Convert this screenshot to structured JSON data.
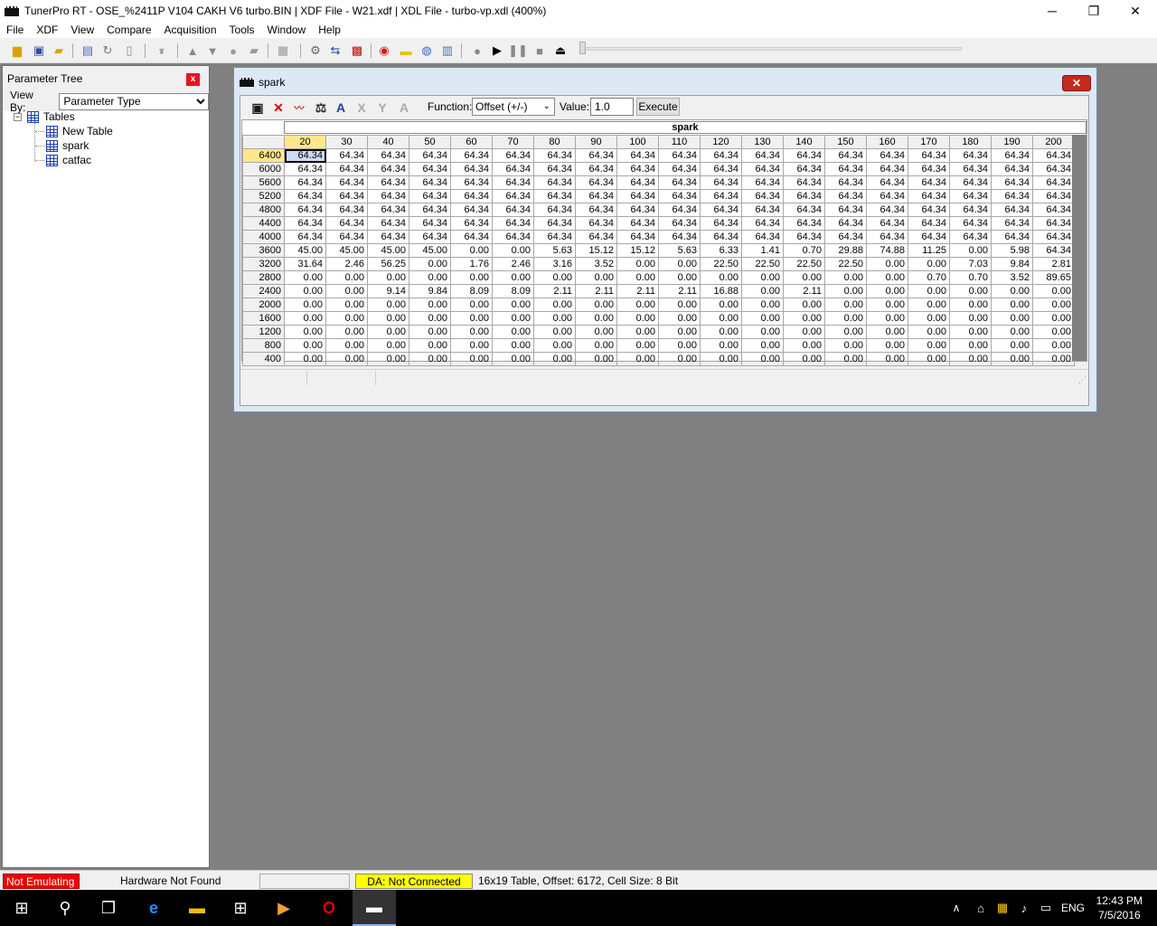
{
  "app": {
    "title": "TunerPro RT - OSE_%2411P V104 CAKH V6 turbo.BIN | XDF File - W21.xdf | XDL File - turbo-vp.xdl (400%)",
    "minimize_glyph": "─",
    "maximize_glyph": "❐",
    "close_glyph": "✕"
  },
  "menu": [
    "File",
    "XDF",
    "View",
    "Compare",
    "Acquisition",
    "Tools",
    "Window",
    "Help"
  ],
  "toolbar_icons": [
    "open-folder-icon",
    "save-icon",
    "open-file-icon",
    "export-icon",
    "refresh-icon",
    "new-icon",
    "probe-icon",
    "arrow-up-icon",
    "arrow-down-icon",
    "circle-icon",
    "stack-icon",
    "chip-icon",
    "settings-icon",
    "swap-icon",
    "compare-icon",
    "record-icon",
    "notes-icon",
    "globe-icon",
    "chart-icon",
    "dot-icon",
    "play-icon",
    "pause-icon",
    "stop-icon",
    "eject-icon"
  ],
  "param_tree": {
    "title": "Parameter Tree",
    "view_by_label": "View By:",
    "view_by_value": "Parameter Type",
    "close_label": "x",
    "root": "Tables",
    "children": [
      "New Table",
      "spark",
      "catfac"
    ]
  },
  "spark_window": {
    "title": "spark",
    "close_label": "✕",
    "function_label": "Function:",
    "function_value": "Offset (+/-)",
    "value_label": "Value:",
    "value": "1.0",
    "execute_label": "Execute",
    "table_title": "spark",
    "columns": [
      "20",
      "30",
      "40",
      "50",
      "60",
      "70",
      "80",
      "90",
      "100",
      "110",
      "120",
      "130",
      "140",
      "150",
      "160",
      "170",
      "180",
      "190",
      "200"
    ],
    "rows": [
      {
        "label": "6400",
        "values": [
          "64.34",
          "64.34",
          "64.34",
          "64.34",
          "64.34",
          "64.34",
          "64.34",
          "64.34",
          "64.34",
          "64.34",
          "64.34",
          "64.34",
          "64.34",
          "64.34",
          "64.34",
          "64.34",
          "64.34",
          "64.34",
          "64.34"
        ]
      },
      {
        "label": "6000",
        "values": [
          "64.34",
          "64.34",
          "64.34",
          "64.34",
          "64.34",
          "64.34",
          "64.34",
          "64.34",
          "64.34",
          "64.34",
          "64.34",
          "64.34",
          "64.34",
          "64.34",
          "64.34",
          "64.34",
          "64.34",
          "64.34",
          "64.34"
        ]
      },
      {
        "label": "5600",
        "values": [
          "64.34",
          "64.34",
          "64.34",
          "64.34",
          "64.34",
          "64.34",
          "64.34",
          "64.34",
          "64.34",
          "64.34",
          "64.34",
          "64.34",
          "64.34",
          "64.34",
          "64.34",
          "64.34",
          "64.34",
          "64.34",
          "64.34"
        ]
      },
      {
        "label": "5200",
        "values": [
          "64.34",
          "64.34",
          "64.34",
          "64.34",
          "64.34",
          "64.34",
          "64.34",
          "64.34",
          "64.34",
          "64.34",
          "64.34",
          "64.34",
          "64.34",
          "64.34",
          "64.34",
          "64.34",
          "64.34",
          "64.34",
          "64.34"
        ]
      },
      {
        "label": "4800",
        "values": [
          "64.34",
          "64.34",
          "64.34",
          "64.34",
          "64.34",
          "64.34",
          "64.34",
          "64.34",
          "64.34",
          "64.34",
          "64.34",
          "64.34",
          "64.34",
          "64.34",
          "64.34",
          "64.34",
          "64.34",
          "64.34",
          "64.34"
        ]
      },
      {
        "label": "4400",
        "values": [
          "64.34",
          "64.34",
          "64.34",
          "64.34",
          "64.34",
          "64.34",
          "64.34",
          "64.34",
          "64.34",
          "64.34",
          "64.34",
          "64.34",
          "64.34",
          "64.34",
          "64.34",
          "64.34",
          "64.34",
          "64.34",
          "64.34"
        ]
      },
      {
        "label": "4000",
        "values": [
          "64.34",
          "64.34",
          "64.34",
          "64.34",
          "64.34",
          "64.34",
          "64.34",
          "64.34",
          "64.34",
          "64.34",
          "64.34",
          "64.34",
          "64.34",
          "64.34",
          "64.34",
          "64.34",
          "64.34",
          "64.34",
          "64.34"
        ]
      },
      {
        "label": "3600",
        "values": [
          "45.00",
          "45.00",
          "45.00",
          "45.00",
          "0.00",
          "0.00",
          "5.63",
          "15.12",
          "15.12",
          "5.63",
          "6.33",
          "1.41",
          "0.70",
          "29.88",
          "74.88",
          "11.25",
          "0.00",
          "5.98",
          "64.34"
        ]
      },
      {
        "label": "3200",
        "values": [
          "31.64",
          "2.46",
          "56.25",
          "0.00",
          "1.76",
          "2.46",
          "3.16",
          "3.52",
          "0.00",
          "0.00",
          "22.50",
          "22.50",
          "22.50",
          "22.50",
          "0.00",
          "0.00",
          "7.03",
          "9.84",
          "2.81"
        ]
      },
      {
        "label": "2800",
        "values": [
          "0.00",
          "0.00",
          "0.00",
          "0.00",
          "0.00",
          "0.00",
          "0.00",
          "0.00",
          "0.00",
          "0.00",
          "0.00",
          "0.00",
          "0.00",
          "0.00",
          "0.00",
          "0.70",
          "0.70",
          "3.52",
          "89.65"
        ]
      },
      {
        "label": "2400",
        "values": [
          "0.00",
          "0.00",
          "9.14",
          "9.84",
          "8.09",
          "8.09",
          "2.11",
          "2.11",
          "2.11",
          "2.11",
          "16.88",
          "0.00",
          "2.11",
          "0.00",
          "0.00",
          "0.00",
          "0.00",
          "0.00",
          "0.00"
        ]
      },
      {
        "label": "2000",
        "values": [
          "0.00",
          "0.00",
          "0.00",
          "0.00",
          "0.00",
          "0.00",
          "0.00",
          "0.00",
          "0.00",
          "0.00",
          "0.00",
          "0.00",
          "0.00",
          "0.00",
          "0.00",
          "0.00",
          "0.00",
          "0.00",
          "0.00"
        ]
      },
      {
        "label": "1600",
        "values": [
          "0.00",
          "0.00",
          "0.00",
          "0.00",
          "0.00",
          "0.00",
          "0.00",
          "0.00",
          "0.00",
          "0.00",
          "0.00",
          "0.00",
          "0.00",
          "0.00",
          "0.00",
          "0.00",
          "0.00",
          "0.00",
          "0.00"
        ]
      },
      {
        "label": "1200",
        "values": [
          "0.00",
          "0.00",
          "0.00",
          "0.00",
          "0.00",
          "0.00",
          "0.00",
          "0.00",
          "0.00",
          "0.00",
          "0.00",
          "0.00",
          "0.00",
          "0.00",
          "0.00",
          "0.00",
          "0.00",
          "0.00",
          "0.00"
        ]
      },
      {
        "label": "800",
        "values": [
          "0.00",
          "0.00",
          "0.00",
          "0.00",
          "0.00",
          "0.00",
          "0.00",
          "0.00",
          "0.00",
          "0.00",
          "0.00",
          "0.00",
          "0.00",
          "0.00",
          "0.00",
          "0.00",
          "0.00",
          "0.00",
          "0.00"
        ]
      },
      {
        "label": "400",
        "values": [
          "0.00",
          "0.00",
          "0.00",
          "0.00",
          "0.00",
          "0.00",
          "0.00",
          "0.00",
          "0.00",
          "0.00",
          "0.00",
          "0.00",
          "0.00",
          "0.00",
          "0.00",
          "0.00",
          "0.00",
          "0.00",
          "0.00"
        ]
      }
    ]
  },
  "status_bar": {
    "emulation": "Not Emulating",
    "hardware": "Hardware Not Found",
    "da": "DA: Not Connected",
    "table_info": "16x19 Table, Offset: 6172,  Cell Size: 8 Bit"
  },
  "taskbar": {
    "language": "ENG",
    "time": "12:43 PM",
    "date": "7/5/2016"
  },
  "colors": {
    "accent_selection": "#ffe88a",
    "error_red": "#ee0000",
    "da_yellow": "#ffff00",
    "mdi_background": "#808080"
  }
}
